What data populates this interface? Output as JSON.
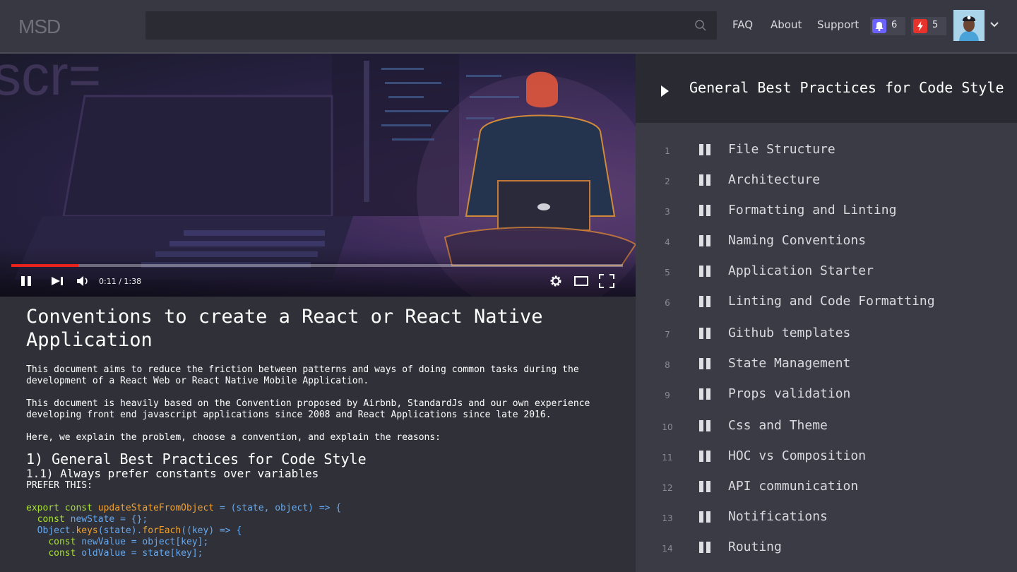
{
  "header": {
    "logo": "MSD",
    "search": {
      "placeholder": ""
    },
    "nav": [
      "FAQ",
      "About",
      "Support"
    ],
    "notifications": {
      "count": "6",
      "color": "#6c63ff",
      "icon": "bell-icon"
    },
    "alerts": {
      "count": "5",
      "color": "#e8322c",
      "icon": "lightning-icon"
    }
  },
  "video": {
    "time": "0:11 / 1:38",
    "progress": 0.11,
    "progress_color": "#e8231f"
  },
  "article": {
    "title": "Conventions to create a React or React Native Application",
    "para1": "This document aims to reduce the friction between patterns and ways of doing common tasks during the development of a React Web or React Native Mobile Application.",
    "para2": "This document is heavily based on the Convention proposed by Airbnb, StandardJs and our own experience developing front end javascript applications since 2008 and React Applications since late 2016.",
    "para3": "Here, we explain the problem, choose a convention, and explain the reasons:",
    "section": "1) General Best Practices for Code Style",
    "subsection": "1.1) Always prefer constants over variables",
    "prefer": "PREFER THIS:",
    "code": {
      "l1_kw": "export const",
      "l1_fn": "updateStateFromObject",
      "l1_rest": "= (state, object) => {",
      "l2_kw": "const",
      "l2_id": "newState",
      "l2_rest": "= {};",
      "l3_a": "Object.",
      "l3_b": "keys",
      "l3_c": "(state).",
      "l3_d": "forEach",
      "l3_e": "((key) => {",
      "l4_kw": "const",
      "l4_id": "newValue",
      "l4_rest": "= object[key];",
      "l5_kw": "const",
      "l5_id": "oldValue",
      "l5_rest": "= state[key];"
    }
  },
  "sidebar": {
    "title": "General Best Practices for Code Style",
    "items": [
      {
        "num": "1",
        "label": "File Structure"
      },
      {
        "num": "2",
        "label": "Architecture"
      },
      {
        "num": "3",
        "label": "Formatting and Linting"
      },
      {
        "num": "4",
        "label": "Naming Conventions"
      },
      {
        "num": "5",
        "label": "Application Starter"
      },
      {
        "num": "6",
        "label": "Linting and Code Formatting"
      },
      {
        "num": "7",
        "label": "Github templates"
      },
      {
        "num": "8",
        "label": "State Management"
      },
      {
        "num": "9",
        "label": "Props validation"
      },
      {
        "num": "10",
        "label": "Css and Theme"
      },
      {
        "num": "11",
        "label": "HOC vs Composition"
      },
      {
        "num": "12",
        "label": "API communication"
      },
      {
        "num": "13",
        "label": "Notifications"
      },
      {
        "num": "14",
        "label": "Routing"
      }
    ]
  }
}
